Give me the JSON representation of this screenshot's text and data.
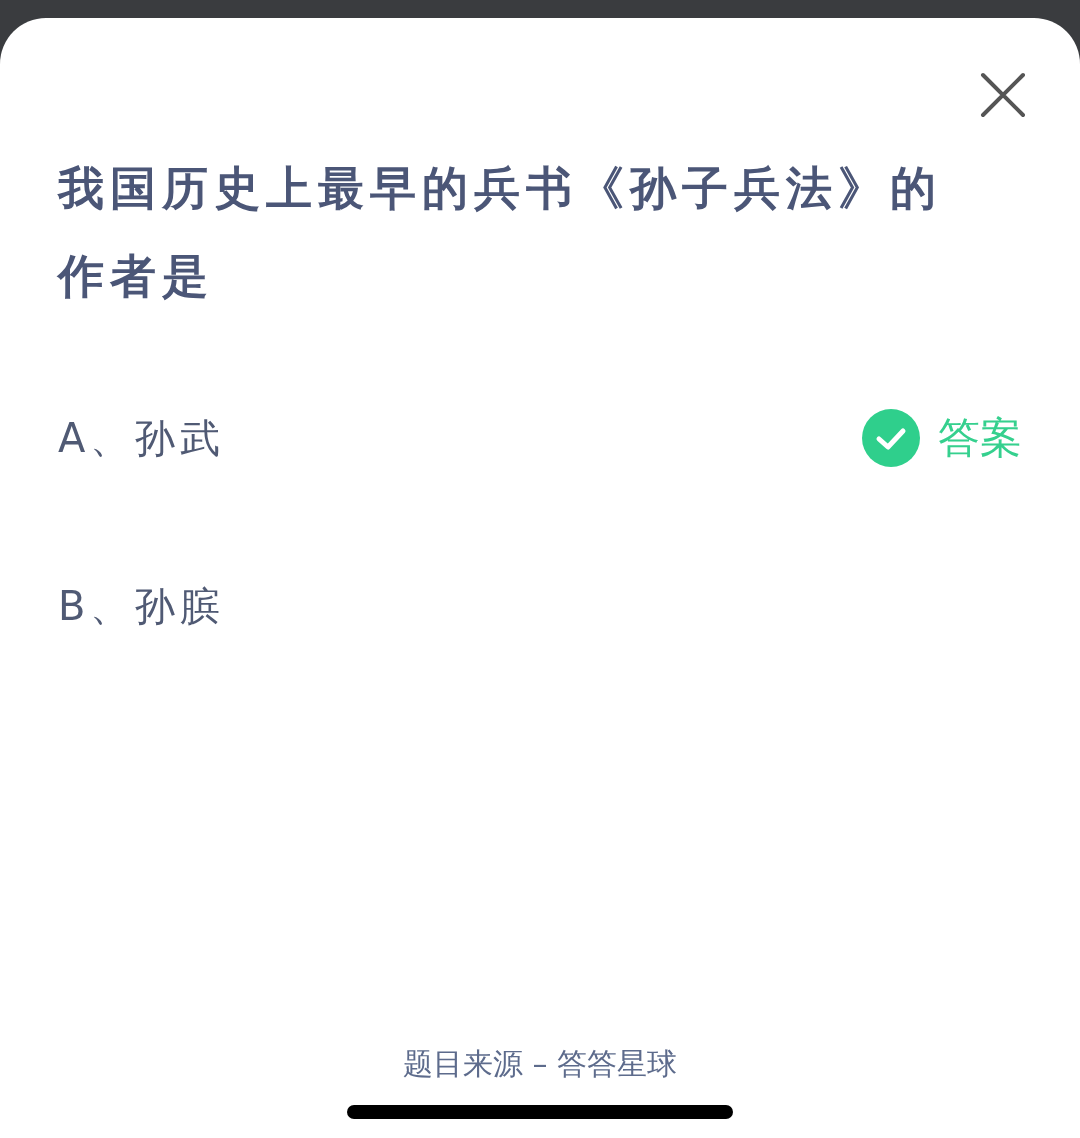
{
  "question": "我国历史上最早的兵书《孙子兵法》的作者是",
  "options": [
    {
      "label": "A、孙武",
      "correct": true,
      "badge": "答案"
    },
    {
      "label": "B、孙膑",
      "correct": false
    }
  ],
  "source": "题目来源 – 答答星球"
}
